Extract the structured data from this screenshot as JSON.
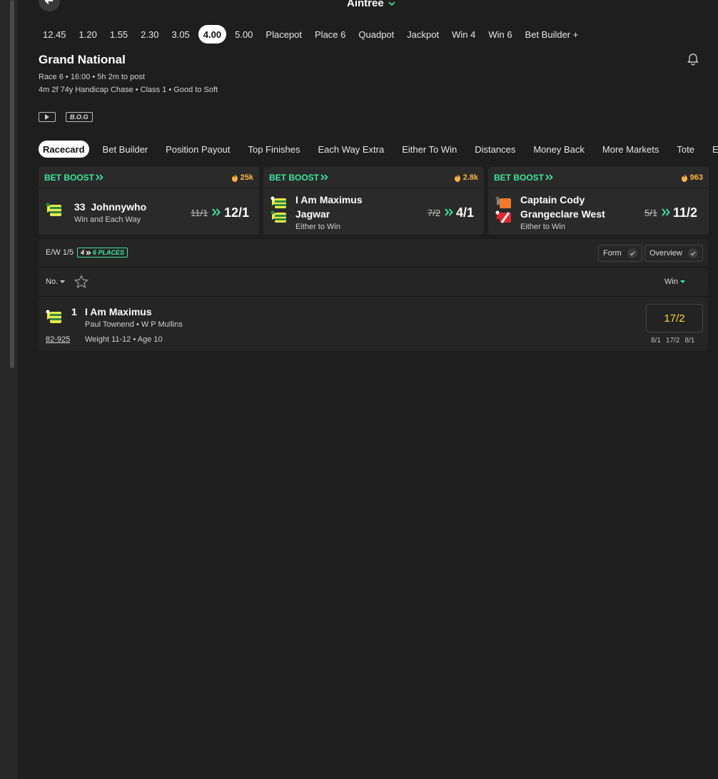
{
  "header": {
    "venue": "Aintree"
  },
  "race_times": [
    "12.45",
    "1.20",
    "1.55",
    "2.30",
    "3.05",
    "4.00",
    "5.00",
    "Placepot",
    "Place 6",
    "Quadpot",
    "Jackpot",
    "Win 4",
    "Win 6",
    "Bet Builder +"
  ],
  "active_time": "4.00",
  "race": {
    "title": "Grand National",
    "meta1": "Race 6 • 16:00 • 5h 2m to post",
    "meta2": "4m 2f 74y Handicap Chase  • Class 1  • Good to Soft",
    "bog": "B.O.G"
  },
  "market_tabs": [
    "Racecard",
    "Bet Builder",
    "Position Payout",
    "Top Finishes",
    "Each Way Extra",
    "Either To Win",
    "Distances",
    "Money Back",
    "More Markets",
    "Tote",
    "Exot"
  ],
  "boosts": [
    {
      "label": "BET BOOST",
      "count": "25k",
      "no": "33",
      "selection": "Johnnywho",
      "selection2": "",
      "sub": "Win and Each Way",
      "old_odds": "11/1",
      "new_odds": "12/1"
    },
    {
      "label": "BET BOOST",
      "count": "2.8k",
      "no": "",
      "selection": "I Am Maximus",
      "selection2": "Jagwar",
      "sub": "Either to Win",
      "old_odds": "7/2",
      "new_odds": "4/1"
    },
    {
      "label": "BET BOOST",
      "count": "963",
      "no": "",
      "selection": "Captain Cody",
      "selection2": "Grangeclare West",
      "sub": "Either to Win",
      "old_odds": "5/1",
      "new_odds": "11/2"
    }
  ],
  "card": {
    "ew": "E/W 1/5",
    "places_n": "4",
    "places_label": "6 PLACES",
    "form_label": "Form",
    "overview_label": "Overview",
    "sort_no": "No.",
    "sort_win": "Win"
  },
  "runner": {
    "no": "1",
    "name": "I Am Maximus",
    "jockey_trainer": "Paul Townend • W P Mullins",
    "form": "82-925",
    "weight_age": "Weight 11-12 • Age 10",
    "odds": "17/2",
    "history": [
      "8/1",
      "17/2",
      "8/1"
    ]
  },
  "colors": {
    "accent": "#3ee6a0",
    "boost_count": "#ffb347",
    "odds": "#ffd43b"
  }
}
